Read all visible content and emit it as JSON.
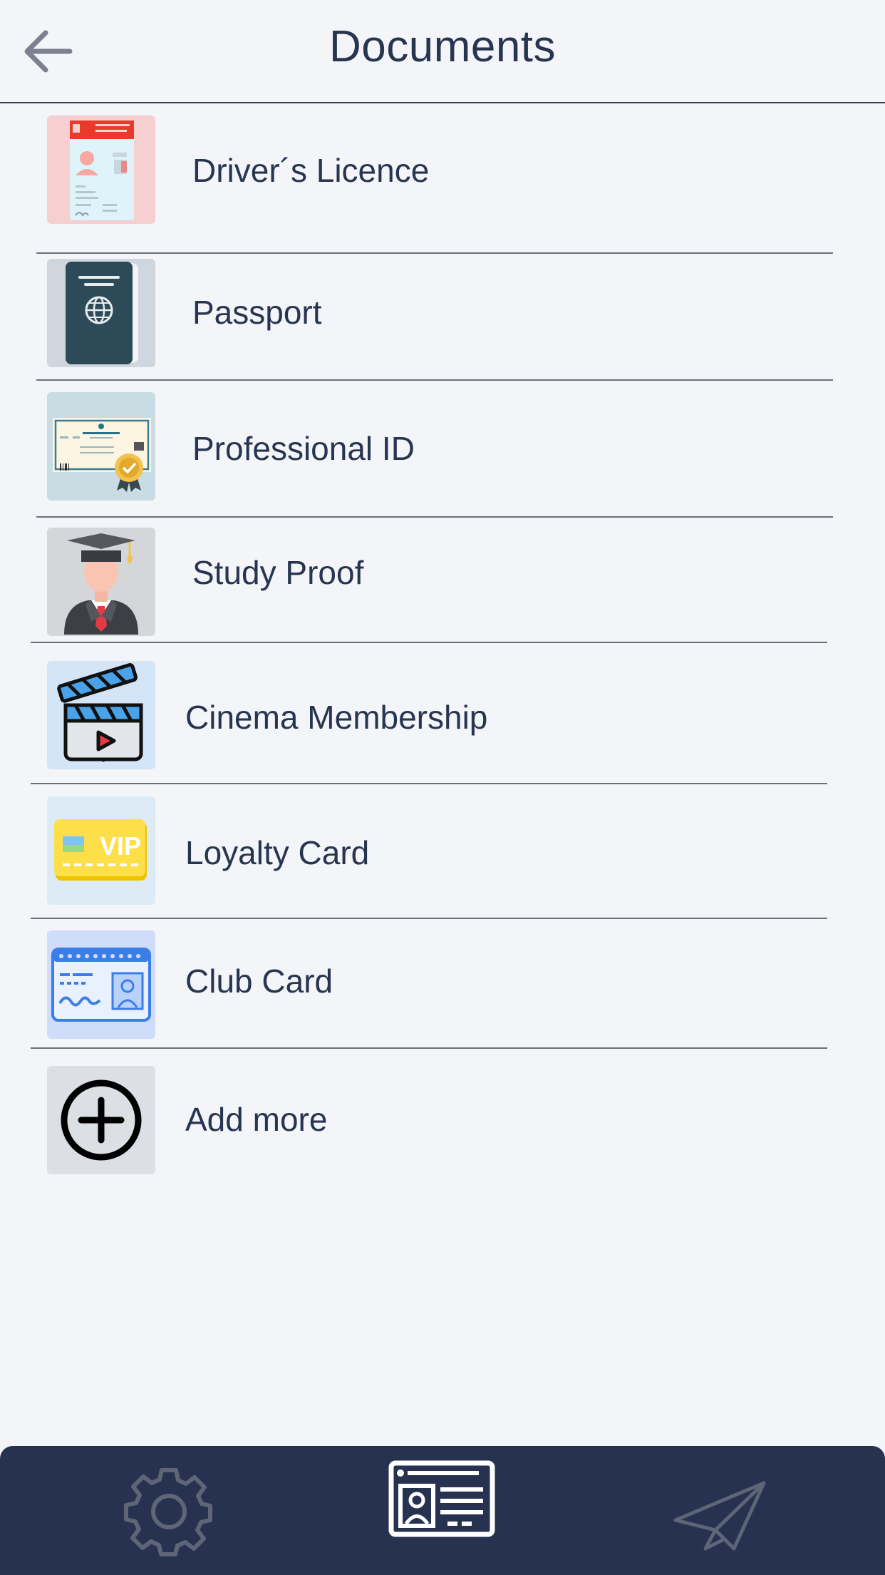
{
  "header": {
    "title": "Documents",
    "back_icon": "arrow-left-icon"
  },
  "documents": [
    {
      "label": "Driver´s Licence",
      "icon": "drivers-licence-icon",
      "bg": "#f6d0d0"
    },
    {
      "label": "Passport",
      "icon": "passport-icon",
      "bg": "#d0d6dd"
    },
    {
      "label": "Professional ID",
      "icon": "certificate-icon",
      "bg": "#c9dbe3"
    },
    {
      "label": "Study Proof",
      "icon": "graduate-icon",
      "bg": "#d4d6da"
    },
    {
      "label": "Cinema Membership",
      "icon": "clapperboard-icon",
      "bg": "#d3e5f6"
    },
    {
      "label": "Loyalty Card",
      "icon": "vip-card-icon",
      "bg": "#dcebf6"
    },
    {
      "label": "Club Card",
      "icon": "id-card-icon",
      "bg": "#cfdcfa"
    },
    {
      "label": "Add more",
      "icon": "plus-circle-icon",
      "bg": "#dcdfe3"
    }
  ],
  "tabbar": {
    "bg": "#263250",
    "tabs": [
      {
        "icon": "gear-icon",
        "active": false
      },
      {
        "icon": "contact-card-icon",
        "active": true
      },
      {
        "icon": "paper-plane-icon",
        "active": false
      }
    ]
  }
}
